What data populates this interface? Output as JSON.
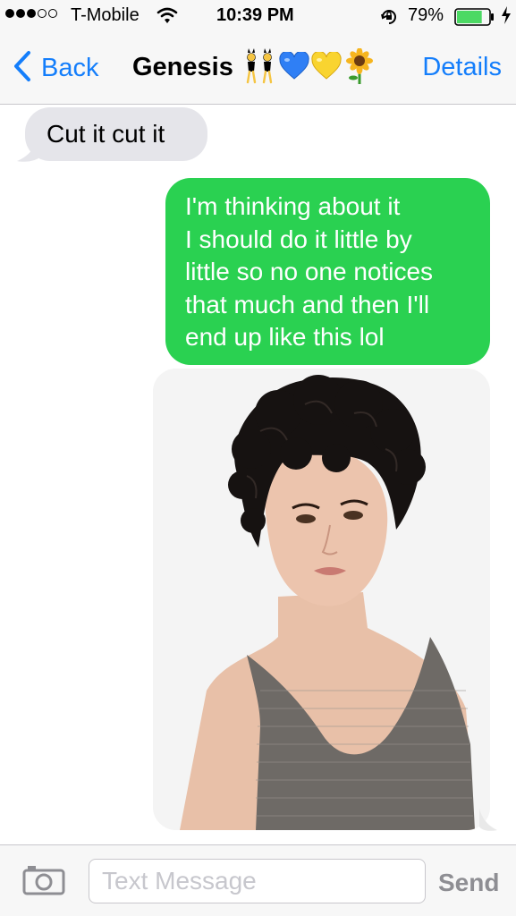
{
  "status_bar": {
    "carrier": "T-Mobile",
    "time": "10:39 PM",
    "battery_percent": "79%",
    "signal_bars_filled": 3,
    "signal_bars_total": 5,
    "battery_level": 0.79
  },
  "nav": {
    "back_label": "Back",
    "title": "Genesis",
    "title_emojis": [
      "dancers-icon",
      "blue-heart-icon",
      "yellow-heart-icon",
      "sunflower-icon"
    ],
    "details_label": "Details"
  },
  "conversation": {
    "messages": [
      {
        "direction": "incoming",
        "type": "text",
        "text": "Cut it cut it"
      },
      {
        "direction": "outgoing",
        "type": "text",
        "lines": [
          "I'm thinking about it",
          "I should do it little by",
          "little so no one notices",
          "that much and then I'll",
          "end up like this lol"
        ]
      },
      {
        "direction": "outgoing",
        "type": "image",
        "image_subject": "photo-of-woman-with-curly-pixie-haircut"
      }
    ]
  },
  "input_bar": {
    "placeholder": "Text Message",
    "send_label": "Send"
  },
  "colors": {
    "ios_blue": "#147efb",
    "outgoing_bubble": "#2ad151",
    "incoming_bubble": "#e5e5ea",
    "bar_background": "#f7f7f7",
    "battery_fill": "#4cd964"
  }
}
